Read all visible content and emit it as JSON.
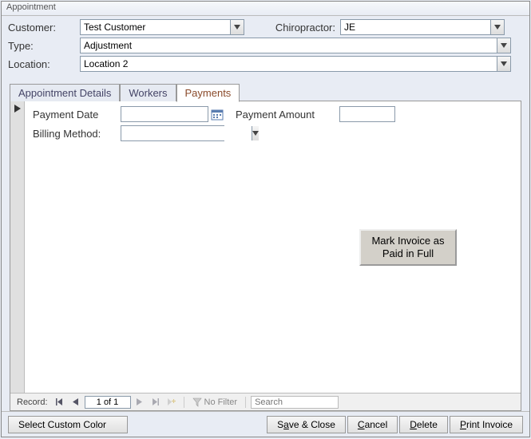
{
  "window_title": "Appointment",
  "header": {
    "customer_label": "Customer:",
    "customer_value": "Test Customer",
    "chiro_label": "Chiropractor:",
    "chiro_value": "JE",
    "type_label": "Type:",
    "type_value": "Adjustment",
    "location_label": "Location:",
    "location_value": "Location 2"
  },
  "tabs": {
    "t0": "Appointment Details",
    "t1": "Workers",
    "t2": "Payments",
    "active_index": 2
  },
  "payments": {
    "payment_date_label": "Payment Date",
    "payment_date_value": "",
    "payment_amount_label": "Payment Amount",
    "payment_amount_value": "",
    "billing_method_label": "Billing Method:",
    "billing_method_value": "",
    "mark_paid_label": "Mark Invoice as Paid in Full"
  },
  "recordnav": {
    "label": "Record:",
    "position": "1 of 1",
    "nofilter": "No Filter",
    "search_placeholder": "Search"
  },
  "footer": {
    "custom_color": "Select Custom Color",
    "save_close_pre": "S",
    "save_close_mn": "a",
    "save_close_post": "ve & Close",
    "cancel_mn": "C",
    "cancel_post": "ancel",
    "delete_mn": "D",
    "delete_post": "elete",
    "print_mn": "P",
    "print_post": "rint Invoice"
  }
}
